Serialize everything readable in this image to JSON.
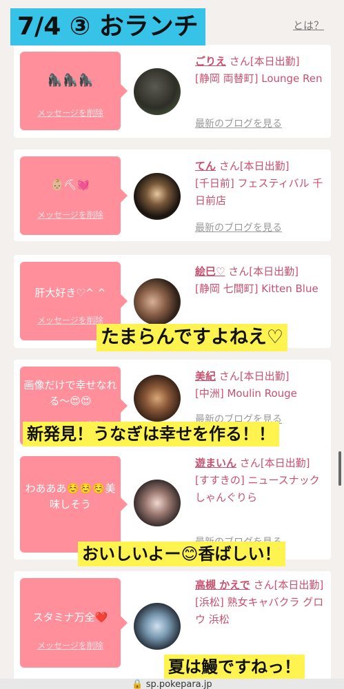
{
  "title_banner": "7/4 ③ おランチ",
  "header_link": "とは？",
  "san_suffix": "さん",
  "delete_label": "メッセージを削除",
  "blog_label": "最新のブログを見る",
  "cards": [
    {
      "message": "🦍🦍🦍",
      "name": "ごりえ",
      "status": "[本日出勤]",
      "shop": "[静岡 両替町] Lounge Ren"
    },
    {
      "message": "👶🏼⛏💓",
      "name": "てん",
      "status": "[本日出勤]",
      "shop": "[千日前] フェスティバル 千日前店"
    },
    {
      "message": "肝大好き♡^ ^",
      "name": "絵巳♡",
      "status": "[本日出勤]",
      "shop": "[静岡 七間町] Kitten Blue"
    },
    {
      "message": "画像だけで幸せなれる〜😍😍",
      "name": "美紀",
      "status": "[本日出勤]",
      "shop": "[中洲] Moulin Rouge"
    },
    {
      "message": "わあああ☺️☺️☺️美味しそう",
      "name": "遊まいん",
      "status": "[本日出勤]",
      "shop": "[すすきの] ニュースナックしゃんぐりら"
    },
    {
      "message": "スタミナ万全❤️",
      "name": "高槻 かえで",
      "status": "[本日出勤]",
      "shop": "[浜松] 熟女キャバクラ グロウ 浜松"
    }
  ],
  "captions": {
    "c1": "たまらんですよねえ♡",
    "c2": "新発見！うなぎは幸せを作る！！",
    "c3": "おいしいよー😊香ばしい！",
    "c4": "夏は鰻ですねっ！"
  },
  "url": "sp.pokepara.jp",
  "colors": {
    "bubble": "#ff8f9a",
    "accent": "#c8506e",
    "banner": "#37c3e8",
    "caption_bg": "#fff44f"
  }
}
